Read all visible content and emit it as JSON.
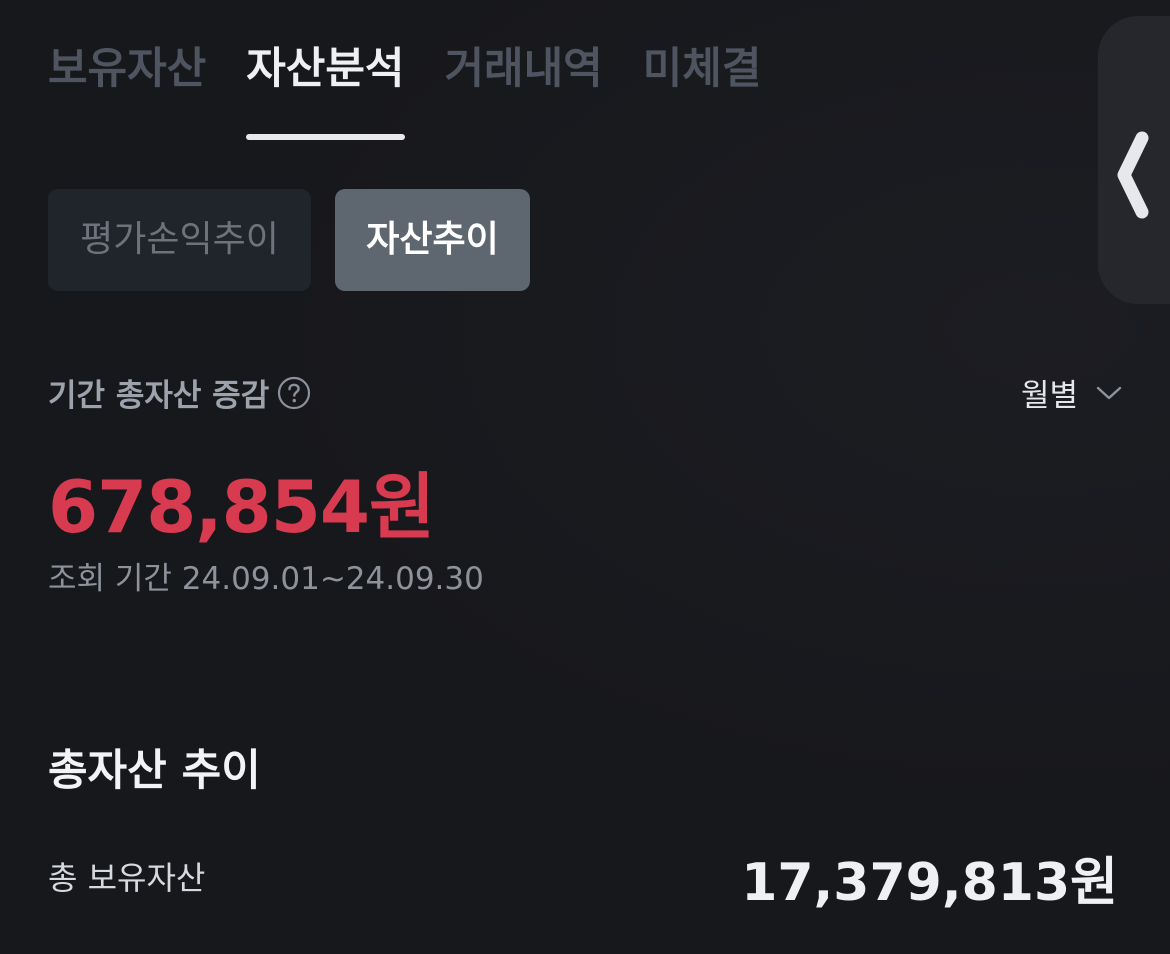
{
  "tabs": [
    {
      "label": "보유자산",
      "active": false
    },
    {
      "label": "자산분석",
      "active": true
    },
    {
      "label": "거래내역",
      "active": false
    },
    {
      "label": "미체결",
      "active": false
    }
  ],
  "sub_tabs": {
    "profit_trend": "평가손익추이",
    "asset_trend": "자산추이",
    "selected": "자산추이"
  },
  "period_change": {
    "label": "기간 총자산 증감",
    "amount": "678,854원",
    "amount_color": "#d83a4f",
    "period_select": "월별",
    "query_period": "조회 기간 24.09.01~24.09.30"
  },
  "trend": {
    "title": "총자산 추이",
    "total_label": "총 보유자산",
    "total_value": "17,379,813원"
  },
  "icons": {
    "help": "question-circle-icon",
    "dropdown": "chevron-down-icon",
    "side_handle": "chevron-left-icon"
  }
}
